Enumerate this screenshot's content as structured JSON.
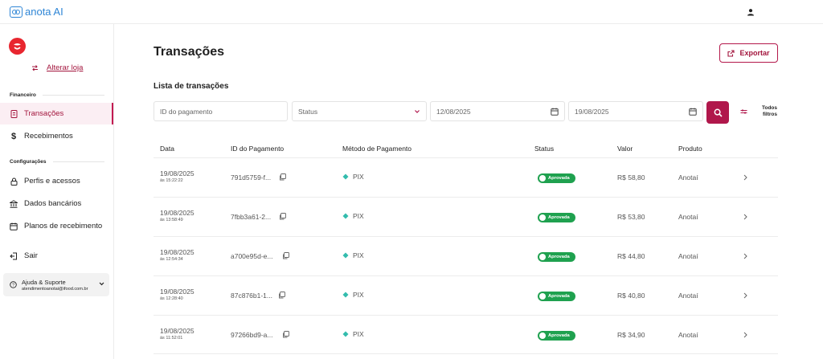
{
  "app": {
    "brand": "anota AI"
  },
  "sidebar": {
    "change_store": "Alterar loja",
    "section_financeiro": "Financeiro",
    "nav_financeiro": [
      {
        "label": "Transações",
        "icon": "receipt-icon",
        "active": true
      },
      {
        "label": "Recebimentos",
        "icon": "dollar-icon",
        "active": false
      }
    ],
    "section_config": "Configurações",
    "nav_config": [
      {
        "label": "Perfis e acessos",
        "icon": "lock-icon"
      },
      {
        "label": "Dados bancários",
        "icon": "bank-icon"
      },
      {
        "label": "Planos de recebimento",
        "icon": "calendar-icon"
      }
    ],
    "logout": "Sair",
    "help": {
      "title": "Ajuda & Suporte",
      "email": "atendimentoanotai@ifood.com.br"
    }
  },
  "page": {
    "title": "Transações",
    "export_label": "Exportar",
    "list_title": "Lista de transações"
  },
  "filters": {
    "payment_id_placeholder": "ID do pagamento",
    "status_placeholder": "Status",
    "date_from": "12/08/2025",
    "date_to": "19/08/2025",
    "all_filters_line1": "Todos",
    "all_filters_line2": "filtros"
  },
  "table": {
    "headers": [
      "Data",
      "ID do Pagamento",
      "Método de Pagamento",
      "Status",
      "Valor",
      "Produto"
    ],
    "rows": [
      {
        "date": "19/08/2025",
        "time": "às 15:22:22",
        "id": "791d5759-f...",
        "method": "PIX",
        "status": "Aprovada",
        "value": "R$ 58,80",
        "product": "Anotaí"
      },
      {
        "date": "19/08/2025",
        "time": "às 13:58:49",
        "id": "7fbb3a61-2...",
        "method": "PIX",
        "status": "Aprovada",
        "value": "R$ 53,80",
        "product": "Anotaí"
      },
      {
        "date": "19/08/2025",
        "time": "às 12:54:34",
        "id": "a700e95d-e...",
        "method": "PIX",
        "status": "Aprovada",
        "value": "R$ 44,80",
        "product": "Anotaí"
      },
      {
        "date": "19/08/2025",
        "time": "às 12:28:40",
        "id": "87c876b1-1...",
        "method": "PIX",
        "status": "Aprovada",
        "value": "R$ 40,80",
        "product": "Anotaí"
      },
      {
        "date": "19/08/2025",
        "time": "às 11:52:01",
        "id": "97266bd9-a...",
        "method": "PIX",
        "status": "Aprovada",
        "value": "R$ 34,90",
        "product": "Anotaí"
      }
    ]
  },
  "colors": {
    "accent": "#b0174b",
    "status_green": "#1fa14f",
    "pix": "#32bcad"
  }
}
